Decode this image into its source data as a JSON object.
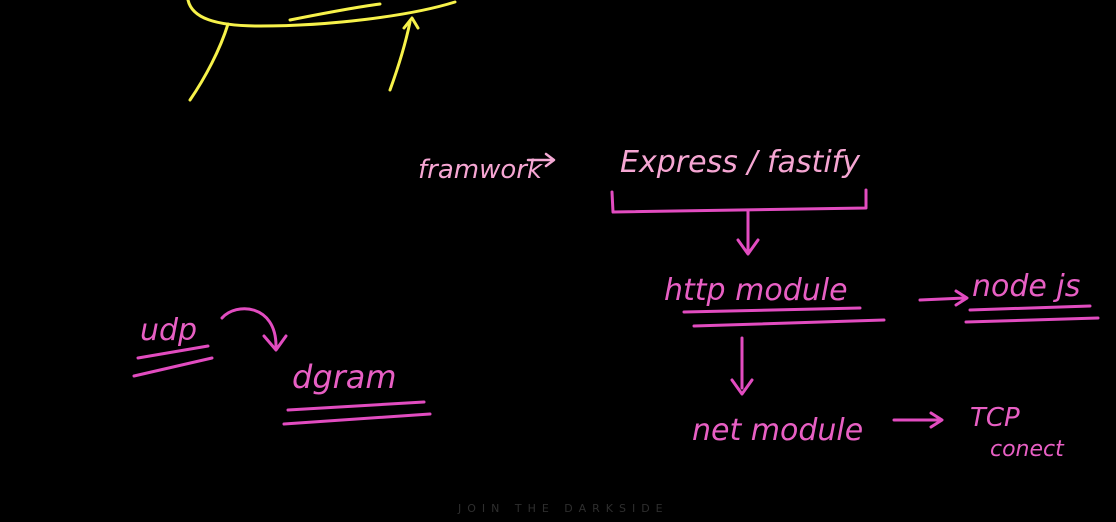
{
  "labels": {
    "framework": "framwork",
    "frameworks_list": "Express / fastify",
    "http_module": "http module",
    "node_js": "node js",
    "net_module": "net module",
    "tcp": "TCP",
    "tcp_sub": "conect",
    "udp": "udp",
    "dgram": "dgram"
  },
  "watermark": "JOIN THE DARKSIDE",
  "colors": {
    "background": "#000000",
    "ink_pink": "#e24cc0",
    "ink_light_pink": "#f4a9d4",
    "ink_yellow": "#f7f24a"
  }
}
